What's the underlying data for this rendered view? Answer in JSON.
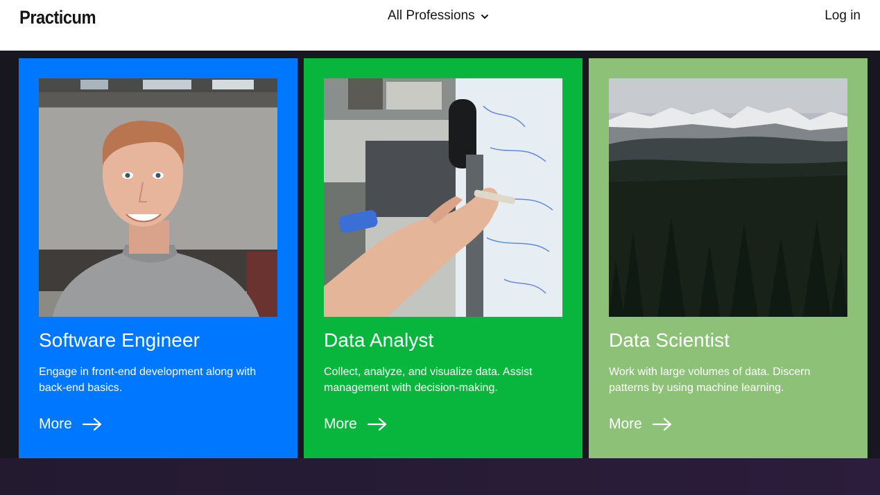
{
  "header": {
    "logo": "Practicum",
    "nav_label": "All Professions",
    "login_label": "Log in"
  },
  "cards": [
    {
      "title": "Software Engineer",
      "description": "Engage in front-end development along with back-end basics.",
      "more_label": "More",
      "color": "#0077ff"
    },
    {
      "title": "Data Analyst",
      "description": "Collect, analyze, and visualize data. Assist management with decision-making.",
      "more_label": "More",
      "color": "#08b53d"
    },
    {
      "title": "Data Scientist",
      "description": "Work with large volumes of data. Discern patterns by using machine learning.",
      "more_label": "More",
      "color": "#8cc177"
    }
  ]
}
